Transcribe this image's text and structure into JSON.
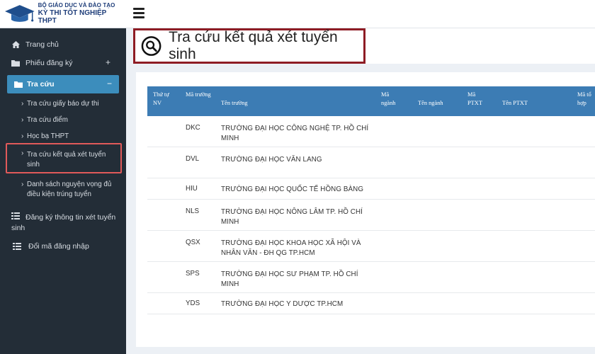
{
  "brand": {
    "line1": "BỘ GIÁO DỤC VÀ ĐÀO TẠO",
    "line2": "KỲ THI TỐT NGHIỆP THPT"
  },
  "sidebar": {
    "home": "Trang chủ",
    "phieu": "Phiếu đăng ký",
    "phieu_toggle": "+",
    "tracuu": "Tra cứu",
    "tracuu_toggle": "−",
    "submenu": [
      "Tra cứu giấy báo dự thi",
      "Tra cứu điểm",
      "Học bạ THPT",
      "Tra cứu kết quả xét tuyển sinh",
      "Danh sách nguyện vọng đủ điều kiện trúng tuyển"
    ],
    "dangky": "Đăng ký thông tin xét tuyển sinh",
    "doima": "Đổi mã đăng nhập"
  },
  "page": {
    "title": "Tra cứu kết quả xét tuyển sinh"
  },
  "table": {
    "headers": {
      "thutu": "Thứ tự NV",
      "matruong": "Mã trường",
      "tentruong": "Tên trường",
      "manganh": "Mã ngành",
      "tennganh": "Tên ngành",
      "maptxt": "Mã PTXT",
      "tenptxt": "Tên PTXT",
      "matohop": "Mã tổ hợp"
    },
    "rows": [
      {
        "code": "DKC",
        "name": "TRƯỜNG ĐẠI HỌC CÔNG NGHỆ TP. HỒ CHÍ MINH"
      },
      {
        "code": "DVL",
        "name": "TRƯỜNG ĐẠI HỌC VĂN LANG"
      },
      {
        "code": "HIU",
        "name": "TRƯỜNG ĐẠI HỌC QUỐC TẾ HỒNG BÀNG"
      },
      {
        "code": "NLS",
        "name": "TRƯỜNG ĐẠI HỌC NÔNG LÂM TP. HỒ CHÍ MINH"
      },
      {
        "code": "QSX",
        "name": "TRƯỜNG ĐẠI HỌC KHOA HỌC XÃ HỘI VÀ NHÂN VĂN - ĐH QG TP.HCM"
      },
      {
        "code": "SPS",
        "name": "TRƯỜNG ĐẠI HỌC SƯ PHẠM TP. HỒ CHÍ MINH"
      },
      {
        "code": "YDS",
        "name": "TRƯỜNG ĐẠI HỌC Y DƯỢC TP.HCM"
      }
    ]
  },
  "colors": {
    "sidebar": "#232d37",
    "accent": "#3c8dbc",
    "table_header": "#3c7cb4",
    "title_border": "#8e1c24",
    "highlight": "#e15a5a"
  },
  "icons": {
    "home": "home-icon",
    "folder": "folder-icon",
    "list": "list-icon",
    "search": "search-icon",
    "menu": "hamburger-icon"
  }
}
